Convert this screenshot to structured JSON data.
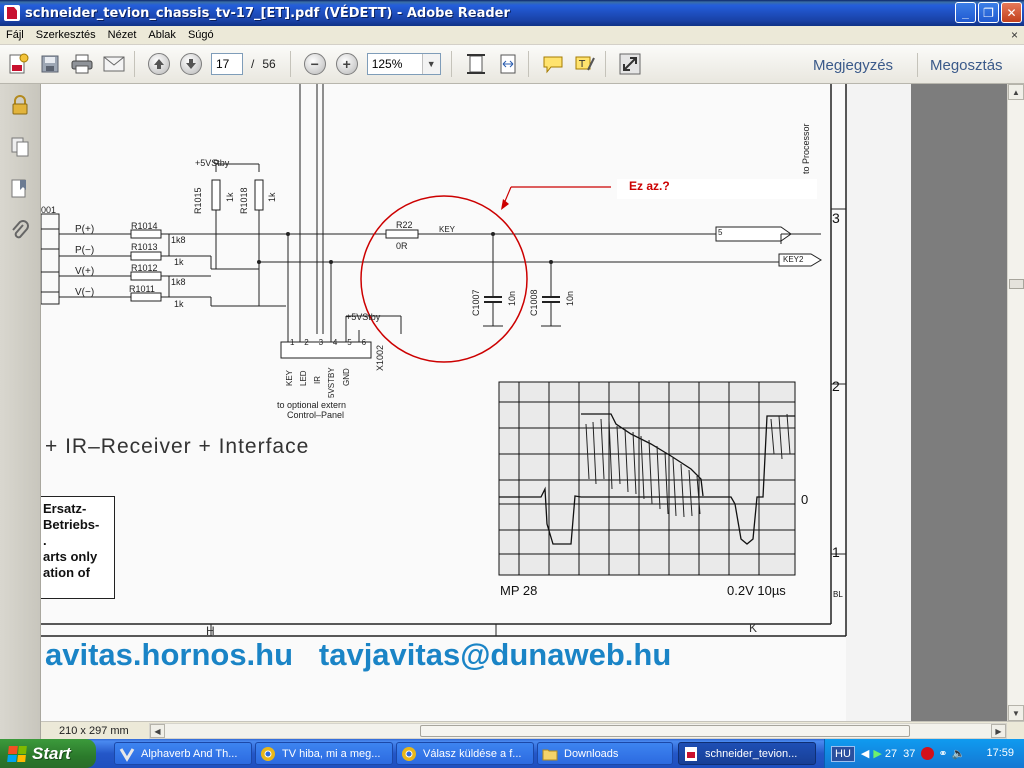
{
  "window": {
    "title": "schneider_tevion_chassis_tv-17_[ET].pdf (VÉDETT) - Adobe Reader",
    "minimize": "_",
    "maximize": "❐",
    "close": "✕"
  },
  "menu": {
    "items": [
      "Fájl",
      "Szerkesztés",
      "Nézet",
      "Ablak",
      "Súgó"
    ],
    "close_glyph": "×"
  },
  "toolbar": {
    "page_current": "17",
    "page_separator": "/",
    "page_total": "56",
    "zoom": "125%",
    "comment_link": "Megjegyzés",
    "share_link": "Megosztás"
  },
  "document": {
    "annotation_note": "Ez az.?",
    "labels": {
      "connector": "001",
      "p_plus": "P(+)",
      "p_minus": "P(−)",
      "v_plus": "V(+)",
      "v_minus": "V(−)",
      "r1014": "R1014",
      "r1013": "R1013",
      "r1012": "R1012",
      "r1011": "R1011",
      "v1k8a": "1k8",
      "v1ka": "1k",
      "v1k8b": "1k8",
      "v1kb": "1k",
      "r1015": "R1015",
      "r1018": "R1018",
      "r1k_a": "1k",
      "r1k_b": "1k",
      "vstby_top": "+5VStby",
      "vstby_mid": "+5VStby",
      "r22": "R22",
      "r22_val": "0R",
      "key_net": "KEY",
      "c1007": "C1007",
      "c1008": "C1008",
      "c10n_a": "10n",
      "c10n_b": "10n",
      "out_5": "5",
      "out_key2": "KEY2",
      "x1002": "X1002",
      "pins": [
        "1",
        "2",
        "3",
        "4",
        "5",
        "6"
      ],
      "pin_names": [
        "KEY",
        "LED",
        "IR",
        "5VSTBY",
        "GND"
      ],
      "optional_1": "to optional extern",
      "optional_2": "Control–Panel",
      "to_processor": "to Processor",
      "heading": "+ IR–Receiver + Interface",
      "box_lines": [
        "Ersatz-",
        "Betriebs-",
        ".",
        "arts only",
        "ation of"
      ],
      "scope_label": "MP 28",
      "scope_scale": "0.2V 10µs",
      "scope_zero": "0",
      "margin_3": "3",
      "margin_2": "2",
      "margin_1": "1",
      "margin_bl": "BL",
      "grid_h": "H",
      "grid_k": "K",
      "footer": "avitas.hornos.hu   tavjavitas@dunaweb.hu"
    }
  },
  "status": {
    "page_size": "210 x 297 mm"
  },
  "taskbar": {
    "start": "Start",
    "tasks": [
      "Alphaverb And Th...",
      "TV hiba, mi a meg...",
      "Válasz küldése a f...",
      "Downloads",
      "schneider_tevion..."
    ],
    "tray_lang": "HU",
    "tray_num1": "27",
    "tray_num2": "37",
    "clock": "17:59"
  }
}
